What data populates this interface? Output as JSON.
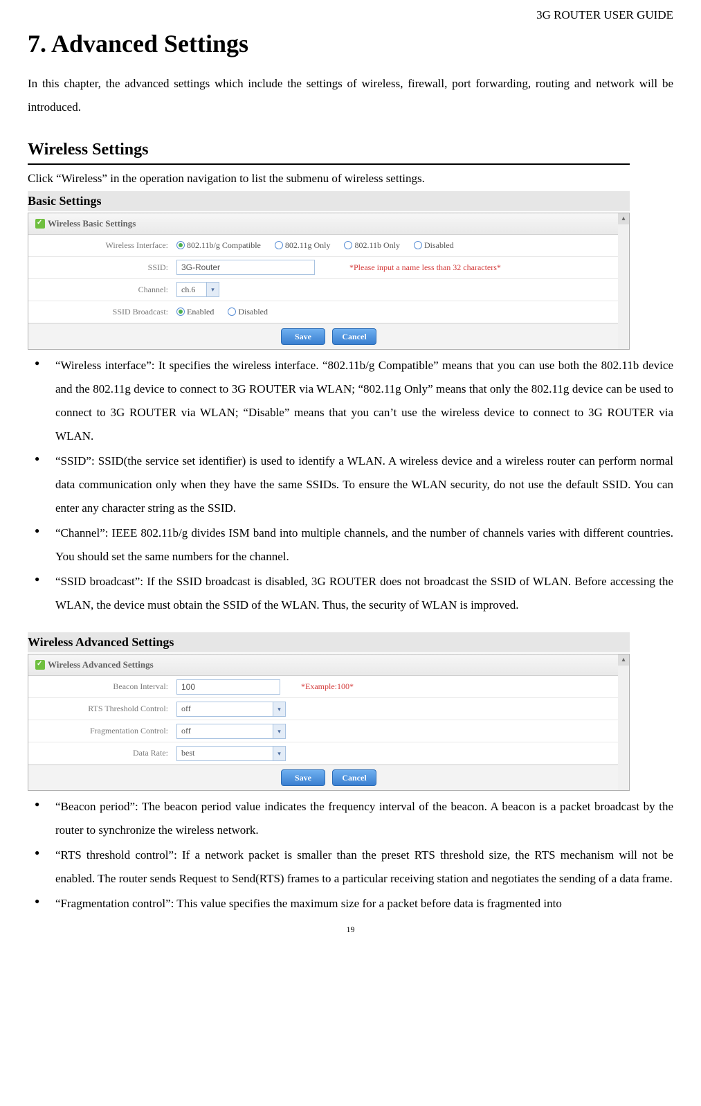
{
  "header": {
    "doc_title": "3G ROUTER USER GUIDE"
  },
  "chapter": {
    "title": "7. Advanced Settings"
  },
  "intro": "In this chapter, the advanced settings which include the settings of wireless, firewall, port forwarding, routing and network will be introduced.",
  "section1": {
    "title": "Wireless Settings",
    "intro": "Click “Wireless” in the operation navigation to list the submenu of wireless settings.",
    "sub1_title": "Basic Settings",
    "sub2_title": "Wireless Advanced Settings"
  },
  "basic_panel": {
    "title": "Wireless Basic Settings",
    "rows": {
      "iface_label": "Wireless Interface:",
      "iface_opts": [
        "802.11b/g Compatible",
        "802.11g Only",
        "802.11b Only",
        "Disabled"
      ],
      "ssid_label": "SSID:",
      "ssid_value": "3G-Router",
      "ssid_hint": "*Please input a name less than 32 characters*",
      "channel_label": "Channel:",
      "channel_value": "ch.6",
      "bcast_label": "SSID Broadcast:",
      "bcast_opts": [
        "Enabled",
        "Disabled"
      ]
    },
    "buttons": {
      "save": "Save",
      "cancel": "Cancel"
    }
  },
  "basic_bullets": [
    "“Wireless interface”: It specifies the wireless interface. “802.11b/g Compatible” means that you can use both the 802.11b device and the 802.11g device to connect to 3G ROUTER via WLAN; “802.11g Only” means that only the 802.11g device can be used to connect to 3G ROUTER via WLAN; “Disable” means that you can’t use the wireless device to connect to 3G ROUTER via WLAN.",
    "“SSID”: SSID(the service set identifier) is used to identify a WLAN. A wireless device and a wireless router can perform normal data communication only when they have the same SSIDs. To ensure the WLAN security, do not use the default SSID. You can enter any character string as the SSID.",
    "“Channel”: IEEE 802.11b/g divides ISM band into multiple channels, and the number of channels varies with different countries. You should set the same numbers for the channel.",
    "“SSID broadcast”: If the SSID broadcast is disabled, 3G ROUTER does not broadcast the SSID of WLAN. Before accessing the WLAN, the device must obtain the SSID of the WLAN. Thus, the security of WLAN is improved."
  ],
  "adv_panel": {
    "title": "Wireless Advanced Settings",
    "rows": {
      "beacon_label": "Beacon Interval:",
      "beacon_value": "100",
      "beacon_hint": "*Example:100*",
      "rts_label": "RTS Threshold Control:",
      "rts_value": "off",
      "frag_label": "Fragmentation Control:",
      "frag_value": "off",
      "rate_label": "Data Rate:",
      "rate_value": "best"
    },
    "buttons": {
      "save": "Save",
      "cancel": "Cancel"
    }
  },
  "adv_bullets": [
    "“Beacon period”: The beacon period value indicates the frequency interval of the beacon. A beacon is a packet broadcast by the router to synchronize the wireless network.",
    "“RTS threshold control”: If a network packet is smaller than the preset RTS threshold size, the RTS mechanism will not be enabled. The router sends Request to Send(RTS) frames to a particular receiving station and negotiates the sending of a data frame.",
    "“Fragmentation control”: This value specifies the maximum size for a packet before data is fragmented into"
  ],
  "page_number": "19"
}
